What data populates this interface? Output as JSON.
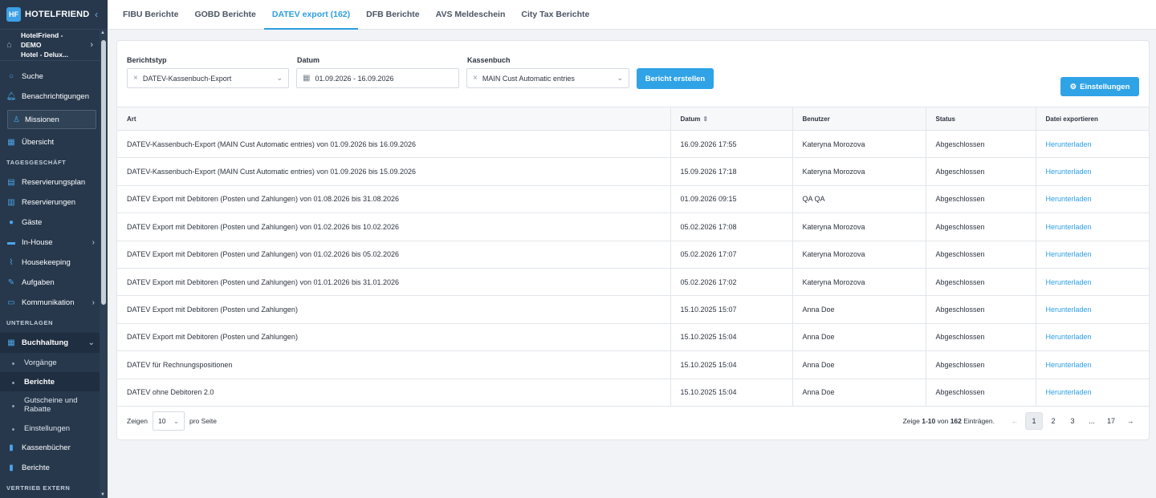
{
  "brand": {
    "name": "HOTELFRIEND",
    "mark": "HF",
    "collapse_icon": "chevron-left-icon"
  },
  "hotel": {
    "line1": "HotelFriend - DEMO",
    "line2": "Hotel - Delux..."
  },
  "sidebar": {
    "top_items": [
      {
        "label": "Suche",
        "icon": "search-icon"
      },
      {
        "label": "Benachrichtigungen",
        "icon": "bell-icon"
      }
    ],
    "mission_label": "Missionen",
    "overview": "Übersicht",
    "section1": "TAGESGESCHÄFT",
    "daily": [
      {
        "label": "Reservierungsplan",
        "icon": "calendar-icon"
      },
      {
        "label": "Reservierungen",
        "icon": "document-icon"
      },
      {
        "label": "Gäste",
        "icon": "user-icon"
      },
      {
        "label": "In-House",
        "icon": "bed-icon",
        "chev": "›"
      },
      {
        "label": "Housekeeping",
        "icon": "broom-icon"
      },
      {
        "label": "Aufgaben",
        "icon": "wrench-icon"
      },
      {
        "label": "Kommunikation",
        "icon": "chat-icon",
        "chev": "›"
      }
    ],
    "section2": "UNTERLAGEN",
    "accounting": {
      "label": "Buchhaltung",
      "icon": "grid-icon",
      "chev": "⌄"
    },
    "sub_items": [
      {
        "label": "Vorgänge"
      },
      {
        "label": "Berichte"
      },
      {
        "label": "Gutscheine und Rabatte"
      },
      {
        "label": "Einstellungen"
      }
    ],
    "after": [
      {
        "label": "Kassenbücher",
        "icon": "book-icon"
      },
      {
        "label": "Berichte",
        "icon": "report-icon"
      }
    ],
    "section3": "VERTRIEB EXTERN"
  },
  "tabs": [
    "FIBU Berichte",
    "GOBD Berichte",
    "DATEV export (162)",
    "DFB Berichte",
    "AVS Meldeschein",
    "City Tax Berichte"
  ],
  "filters": {
    "type_label": "Berichtstyp",
    "type_value": "DATEV-Kassenbuch-Export",
    "date_label": "Datum",
    "date_value": "01.09.2026 - 16.09.2026",
    "cash_label": "Kassenbuch",
    "cash_value": "MAIN Cust Automatic entries",
    "create_button": "Bericht erstellen",
    "settings_button": "Einstellungen"
  },
  "table": {
    "headers": [
      "Art",
      "Datum",
      "Benutzer",
      "Status",
      "Datei exportieren"
    ],
    "rows": [
      [
        "DATEV-Kassenbuch-Export (MAIN Cust Automatic entries) von 01.09.2026 bis 16.09.2026",
        "16.09.2026 17:55",
        "Kateryna Morozova",
        "Abgeschlossen",
        "Herunterladen"
      ],
      [
        "DATEV-Kassenbuch-Export (MAIN Cust Automatic entries) von 01.09.2026 bis 15.09.2026",
        "15.09.2026 17:18",
        "Kateryna Morozova",
        "Abgeschlossen",
        "Herunterladen"
      ],
      [
        "DATEV Export mit Debitoren (Posten und Zahlungen) von 01.08.2026 bis 31.08.2026",
        "01.09.2026 09:15",
        "QA QA",
        "Abgeschlossen",
        "Herunterladen"
      ],
      [
        "DATEV Export mit Debitoren (Posten und Zahlungen) von 01.02.2026 bis 10.02.2026",
        "05.02.2026 17:08",
        "Kateryna Morozova",
        "Abgeschlossen",
        "Herunterladen"
      ],
      [
        "DATEV Export mit Debitoren (Posten und Zahlungen) von 01.02.2026 bis 05.02.2026",
        "05.02.2026 17:07",
        "Kateryna Morozova",
        "Abgeschlossen",
        "Herunterladen"
      ],
      [
        "DATEV Export mit Debitoren (Posten und Zahlungen) von 01.01.2026 bis 31.01.2026",
        "05.02.2026 17:02",
        "Kateryna Morozova",
        "Abgeschlossen",
        "Herunterladen"
      ],
      [
        "DATEV Export mit Debitoren (Posten und Zahlungen)",
        "15.10.2025 15:07",
        "Anna Doe",
        "Abgeschlossen",
        "Herunterladen"
      ],
      [
        "DATEV Export mit Debitoren (Posten und Zahlungen)",
        "15.10.2025 15:04",
        "Anna Doe",
        "Abgeschlossen",
        "Herunterladen"
      ],
      [
        "DATEV für Rechnungspositionen",
        "15.10.2025 15:04",
        "Anna Doe",
        "Abgeschlossen",
        "Herunterladen"
      ],
      [
        "DATEV ohne Debitoren 2.0",
        "15.10.2025 15:04",
        "Anna Doe",
        "Abgeschlossen",
        "Herunterladen"
      ]
    ]
  },
  "footer": {
    "show": "Zeigen",
    "per_page_value": "10",
    "per_page_suffix": "pro Seite",
    "range_prefix": "Zeige ",
    "range": "1-10",
    "range_mid": " von ",
    "total": "162",
    "range_suffix": " Einträgen.",
    "pages": [
      "1",
      "2",
      "3",
      "...",
      "17"
    ],
    "prev": "←",
    "next": "→"
  },
  "colors": {
    "accent": "#2d9fe0",
    "sidebar": "#27384c"
  }
}
